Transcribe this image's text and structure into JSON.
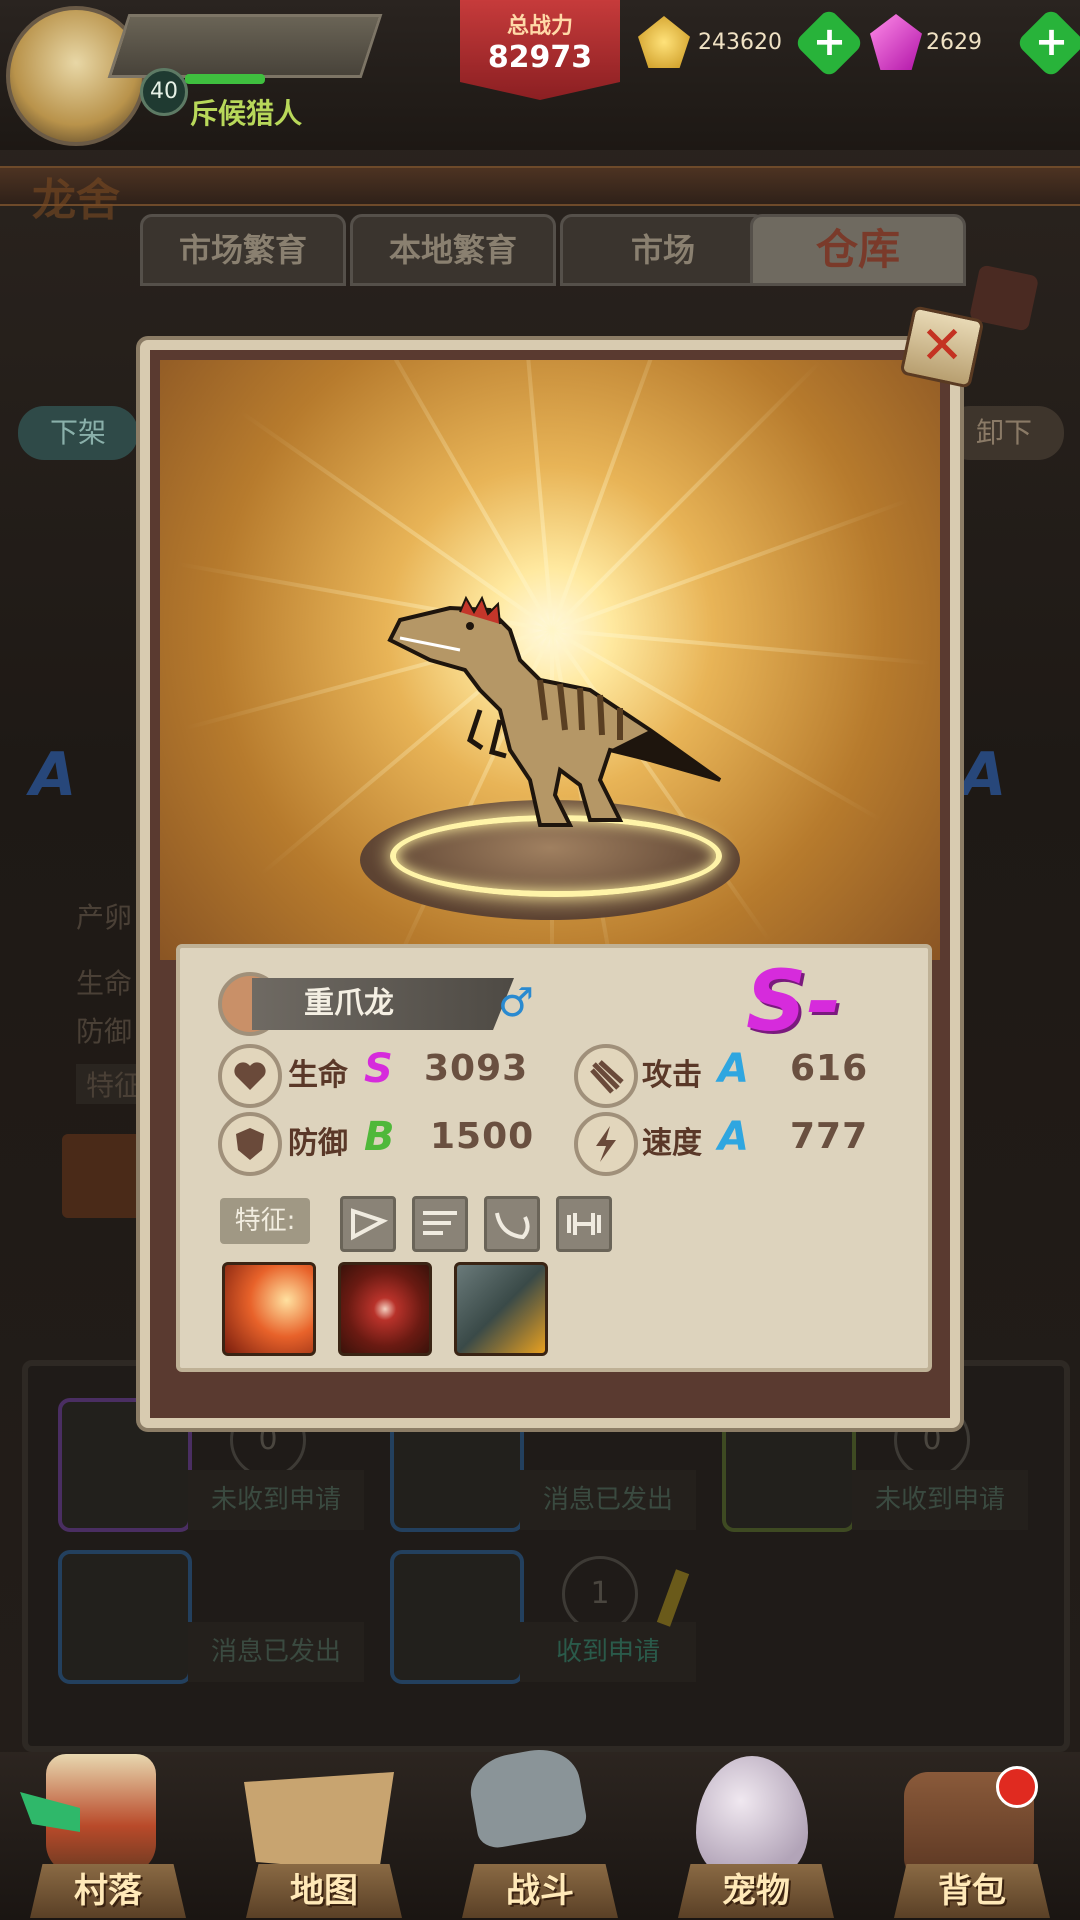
{
  "player": {
    "level": "40",
    "name": "斥候猎人"
  },
  "power": {
    "label": "总战力",
    "value": "82973"
  },
  "currency": {
    "gold": "243620",
    "gems": "2629",
    "add": "+"
  },
  "background": {
    "title": "龙舍",
    "tabs": [
      "市场繁育",
      "本地繁育",
      "市场",
      "仓库"
    ],
    "left_button": "下架",
    "right_button": "卸下",
    "grade_left": "A",
    "grade_right": "A",
    "text_lines": [
      "产卵",
      "生命",
      "防御",
      "特征"
    ],
    "slots": [
      {
        "count": "0",
        "message": "未收到申请"
      },
      {
        "count": "",
        "message": "消息已发出"
      },
      {
        "count": "0",
        "message": "未收到申请"
      },
      {
        "count": "",
        "message": "消息已发出"
      },
      {
        "count": "1",
        "message": "收到申请"
      }
    ]
  },
  "dialog": {
    "close": "✕",
    "dino_name": "重爪龙",
    "gender": "♂",
    "rank": "S-",
    "stats": [
      {
        "label": "生命",
        "grade": "S",
        "value": "3093",
        "icon": "heart-icon"
      },
      {
        "label": "攻击",
        "grade": "A",
        "value": "616",
        "icon": "claw-icon"
      },
      {
        "label": "防御",
        "grade": "B",
        "value": "1500",
        "icon": "shield-icon"
      },
      {
        "label": "速度",
        "grade": "A",
        "value": "777",
        "icon": "lightning-icon"
      }
    ],
    "traits_label": "特征:",
    "traits": [
      "jaw-trait-icon",
      "wing-trait-icon",
      "tail-trait-icon",
      "dumbbell-trait-icon"
    ],
    "skills": [
      "fire-claw-skill-icon",
      "dragon-eye-skill-icon",
      "roar-skill-icon"
    ]
  },
  "nav": [
    "村落",
    "地图",
    "战斗",
    "宠物",
    "背包"
  ]
}
